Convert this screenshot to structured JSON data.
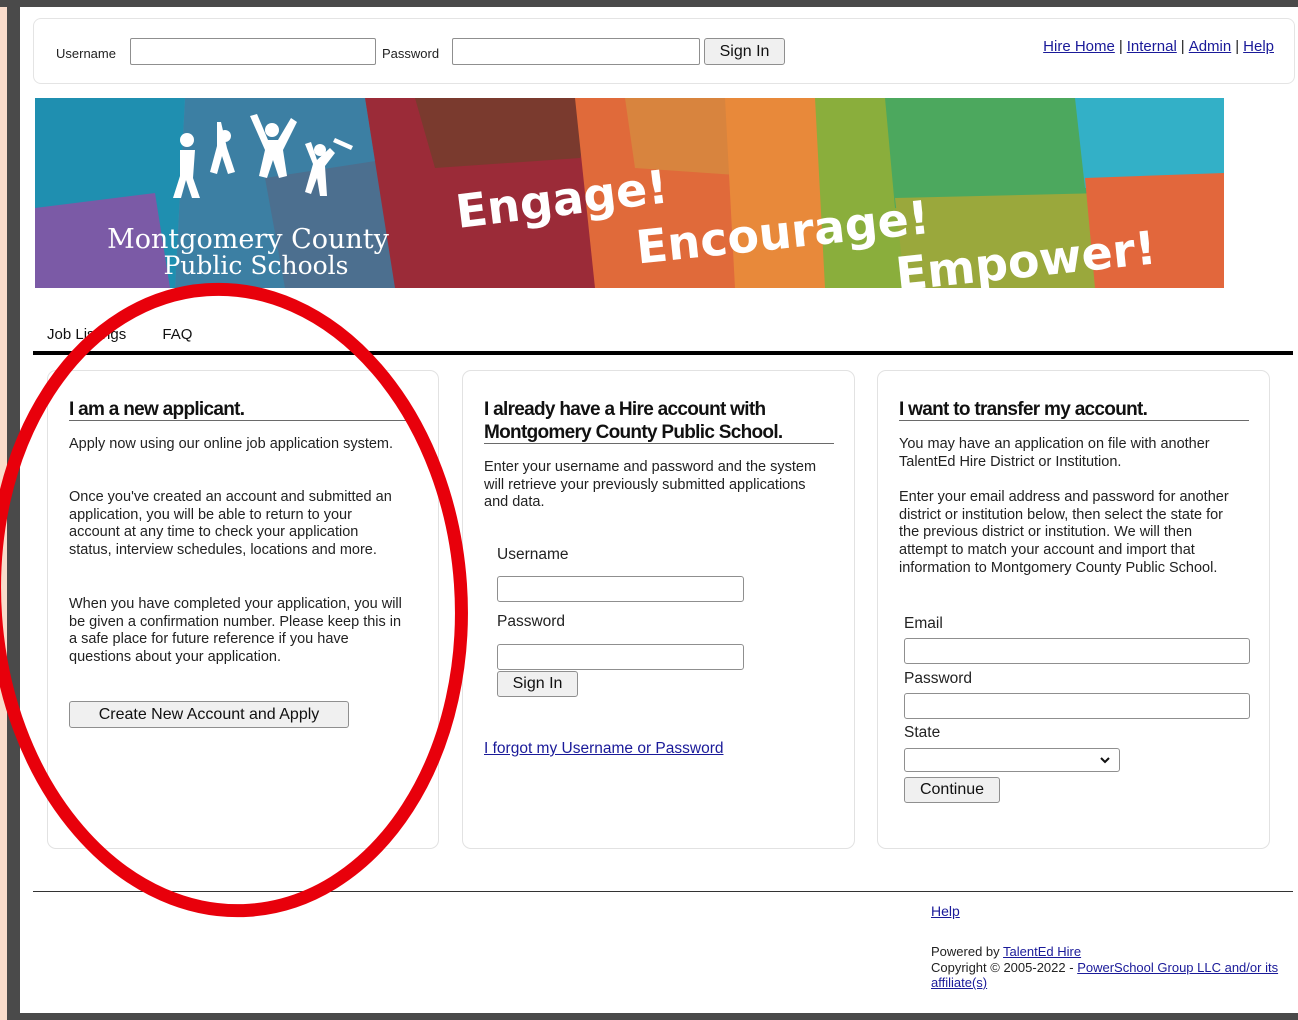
{
  "topbar": {
    "username_label": "Username",
    "password_label": "Password",
    "username_value": "",
    "password_value": "",
    "signin_label": "Sign In",
    "links": [
      "Hire Home",
      "Internal",
      "Admin",
      "Help"
    ],
    "separator": "|"
  },
  "banner": {
    "org_line1": "Montgomery County",
    "org_line2": "Public Schools",
    "slogan_1": "Engage!",
    "slogan_2": "Encourage!",
    "slogan_3": "Empower!"
  },
  "nav": {
    "tabs": [
      "Job Listings",
      "FAQ"
    ]
  },
  "new_applicant": {
    "title": "I am a new applicant.",
    "para1": "Apply now using our online job application system.",
    "para2": "Once you've created an account and submitted an application, you will be able to return to your account at any time to check your application status, interview schedules, locations and more.",
    "para3": "When you have completed your application, you will be given a confirmation number. Please keep this in a safe place for future reference if you have questions about your application.",
    "button": "Create New Account and Apply"
  },
  "existing_account": {
    "title_line1": "I already have a Hire account with",
    "title_line2": "Montgomery County Public School.",
    "para": "Enter your username and password and the system will retrieve your previously submitted applications and data.",
    "username_label": "Username",
    "password_label": "Password",
    "signin_label": "Sign In",
    "forgot_link": "I forgot my Username or Password"
  },
  "transfer": {
    "title": "I want to transfer my account.",
    "para1": "You may have an application on file with another TalentEd Hire District or Institution.",
    "para2": "Enter your email address and password for another district or institution below, then select the state for the previous district or institution. We will then attempt to match your account and import that information to Montgomery County Public School.",
    "email_label": "Email",
    "password_label": "Password",
    "state_label": "State",
    "state_selected": "",
    "continue_label": "Continue"
  },
  "footer": {
    "help_link": "Help",
    "powered_by": "Powered by",
    "talented_link": "TalentEd Hire",
    "copyright": "Copyright © 2005-2022  -",
    "powerschool_link": "PowerSchool Group LLC and/or its affiliate(s)"
  },
  "colors": {
    "link": "#1a1a99",
    "annotation_circle": "#e8000b",
    "frame": "#4a4a4a",
    "outer_background": "#f9dccb"
  }
}
